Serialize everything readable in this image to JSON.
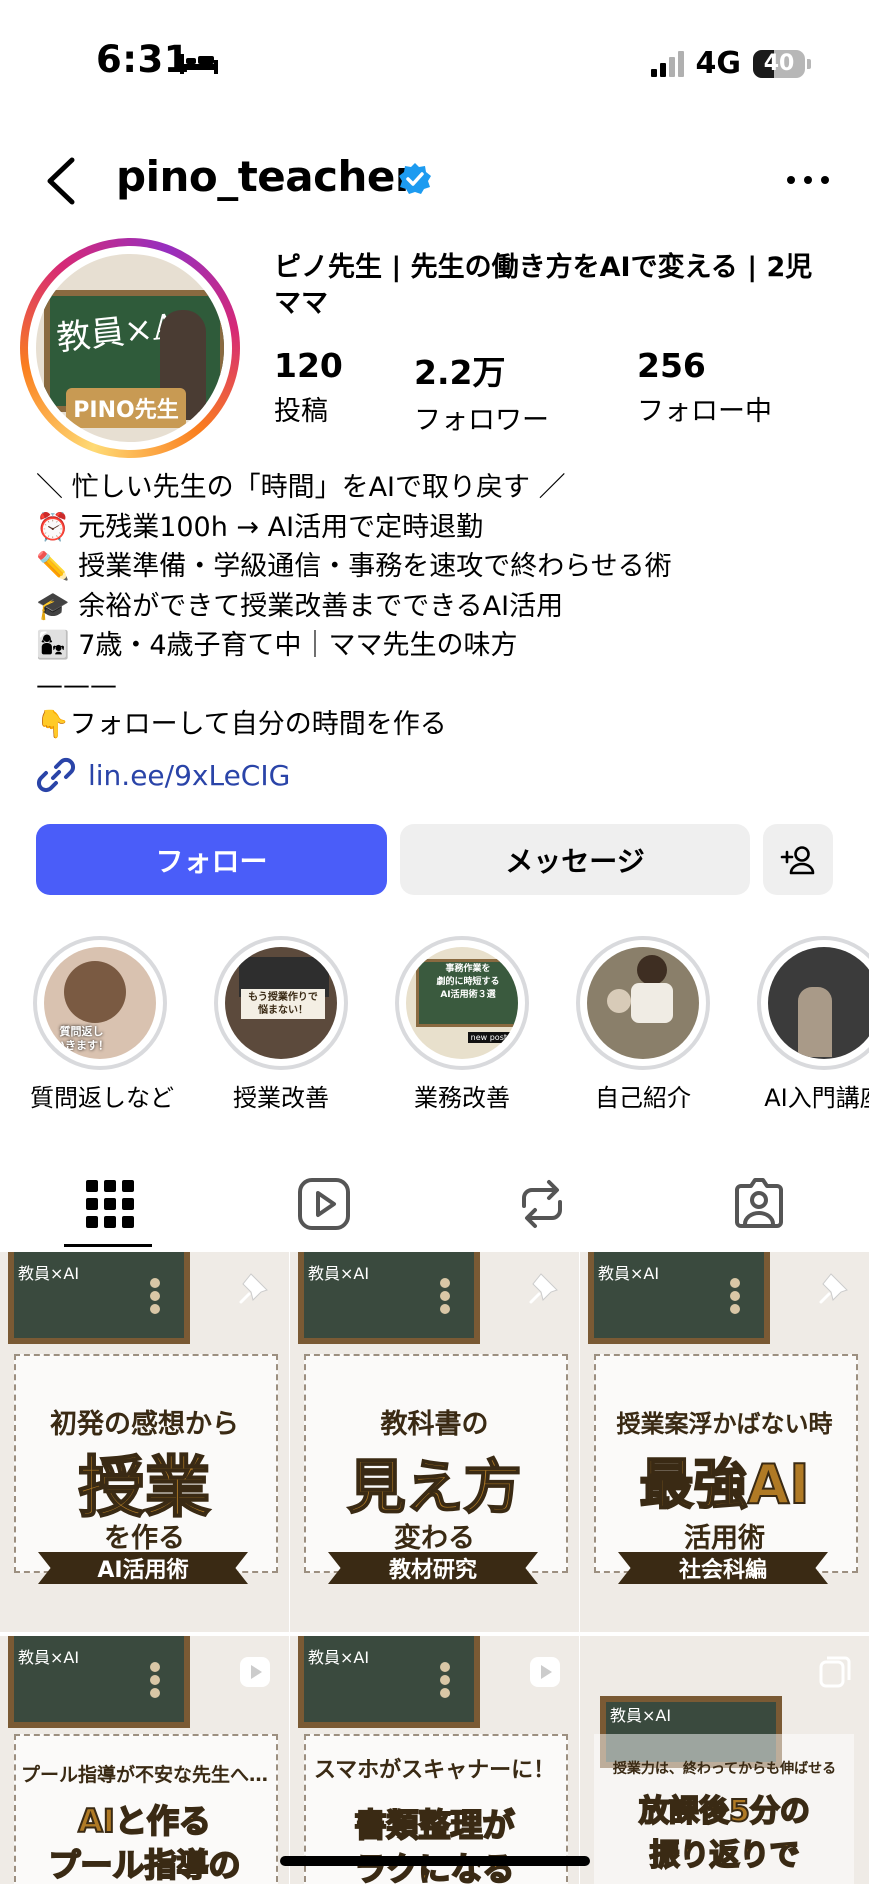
{
  "status": {
    "time": "6:31",
    "network": "4G",
    "battery": "40",
    "battery_level": 0.4
  },
  "header": {
    "username": "pino_teacher"
  },
  "profile": {
    "display_name": "ピノ先生 | 先生の働き方をAIで変える | 2児ママ",
    "avatar_text": "教員×AI",
    "avatar_label": "PINO先生",
    "stats": [
      {
        "value": "120",
        "label": "投稿"
      },
      {
        "value": "2.2万",
        "label": "フォロワー"
      },
      {
        "value": "256",
        "label": "フォロー中"
      }
    ],
    "bio": [
      "＼ 忙しい先生の「時間」をAIで取り戻す ／",
      "⏰ 元残業100h → AI活用で定時退勤",
      "✏️ 授業準備・学級通信・事務を速攻で終わらせる術",
      "🎓 余裕ができて授業改善までできるAI活用",
      "👩‍👧 7歳・4歳子育て中｜ママ先生の味方",
      "———",
      "👇フォローして自分の時間を作る"
    ],
    "link": "lin.ee/9xLeCIG"
  },
  "actions": {
    "follow": "フォロー",
    "message": "メッセージ"
  },
  "highlights": [
    {
      "label": "質問返しなど",
      "overlay": "質問返し\nいきます！",
      "color": "#d9c2b0"
    },
    {
      "label": "授業改善",
      "overlay": "もう授業作りで\n悩まない！",
      "color": "#5c4a3c"
    },
    {
      "label": "業務改善",
      "overlay": "事務作業を\n劇的に時短する\nAI活用術３選",
      "color": "#3a5a3e"
    },
    {
      "label": "自己紹介",
      "overlay": "",
      "color": "#8a7f6a"
    },
    {
      "label": "AI入門講座",
      "overlay": "",
      "color": "#3b3b3b"
    }
  ],
  "posts": [
    {
      "tag": "教員×AI",
      "line1": "初発の感想から",
      "big": "授業",
      "line2": "を作る",
      "ribbon": "AI活用術",
      "badge": "pin"
    },
    {
      "tag": "教員×AI",
      "line1": "教科書の",
      "big": "見え方",
      "line2": "変わる",
      "ribbon": "教材研究",
      "badge": "pin"
    },
    {
      "tag": "教員×AI",
      "line1": "授業案浮かばない時",
      "big": "最強AI",
      "line2": "活用術",
      "ribbon": "社会科編",
      "badge": "pin"
    },
    {
      "tag": "教員×AI",
      "line1": "プール指導が不安な先生へ…",
      "big": "AIと作る",
      "line2": "プール指導の",
      "ribbon": "",
      "badge": "reel"
    },
    {
      "tag": "教員×AI",
      "line1": "スマホがスキャナーに！",
      "big": "書類整理が",
      "line2": "ラクになる",
      "ribbon": "",
      "badge": "reel"
    },
    {
      "tag": "教員×AI",
      "line1": "授業力は、終わってからも伸ばせる",
      "big": "放課後5分の",
      "line2": "振り返りで",
      "ribbon": "",
      "badge": "carousel"
    }
  ],
  "colors": {
    "follow": "#4a5df9",
    "link": "#2a44a8",
    "verified": "#1d9bf0"
  },
  "icons": [
    "back-icon",
    "verified-icon",
    "more-icon",
    "link-icon",
    "add-person-icon",
    "grid-icon",
    "reels-icon",
    "reposts-icon",
    "tagged-icon"
  ]
}
